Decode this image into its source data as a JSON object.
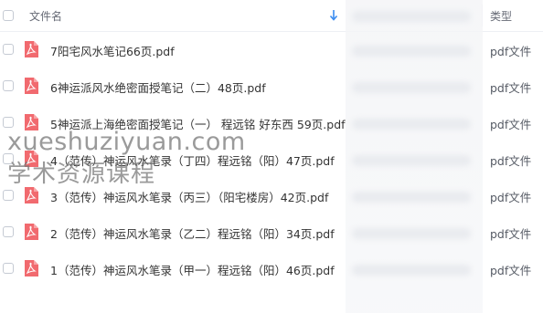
{
  "header": {
    "name_label": "文件名",
    "type_label": "类型",
    "sort_icon": "sort-descending-arrow-icon"
  },
  "files": [
    {
      "name": "7阳宅风水笔记66页.pdf",
      "type": "pdf文件"
    },
    {
      "name": "6神运派风水绝密面授笔记（二）48页.pdf",
      "type": "pdf文件"
    },
    {
      "name": "5神运派上海绝密面授笔记（一） 程远铭 好东西 59页.pdf",
      "type": "pdf文件"
    },
    {
      "name": "4（范传）神运风水笔录（丁四）程远铭（阳）47页.pdf",
      "type": "pdf文件"
    },
    {
      "name": "3（范传）神运风水笔录（丙三）（阳宅楼房）42页.pdf",
      "type": "pdf文件"
    },
    {
      "name": "2（范传）神运风水笔录（乙二）程远铭（阳）34页.pdf",
      "type": "pdf文件"
    },
    {
      "name": "1（范传）神运风水笔录（甲一）程远铭（阳）46页.pdf",
      "type": "pdf文件"
    }
  ],
  "watermark": {
    "line1": "xueshuziyuan.com",
    "line2": "学术资源课程"
  },
  "colors": {
    "pdf_icon": "#f16a6f",
    "sort_arrow": "#3b8cf0"
  }
}
